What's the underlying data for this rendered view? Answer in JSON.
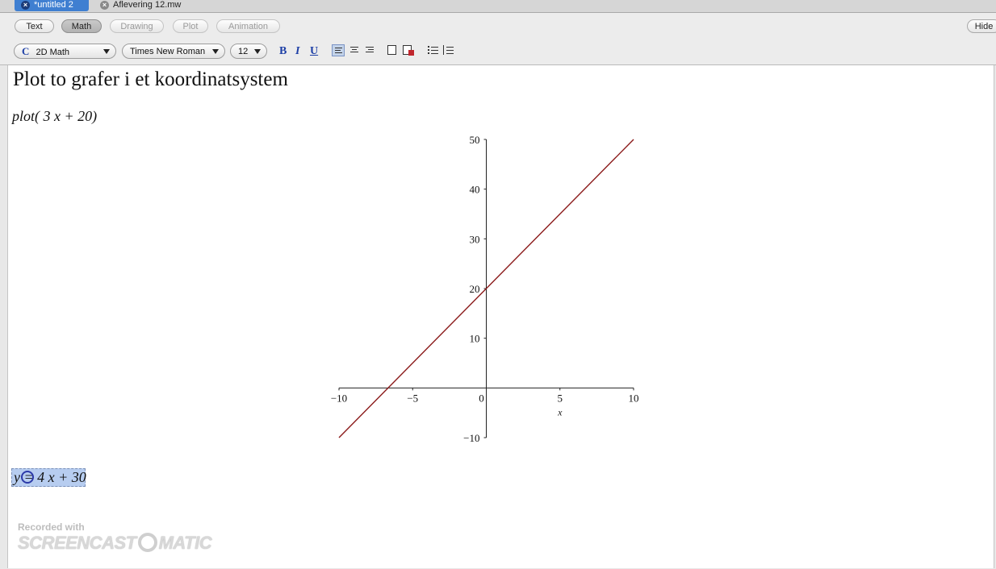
{
  "tabs": [
    {
      "label": "*untitled 2",
      "active": true
    },
    {
      "label": "Aflevering 12.mw",
      "active": false
    }
  ],
  "modes": {
    "text": "Text",
    "math": "Math",
    "drawing": "Drawing",
    "plot": "Plot",
    "animation": "Animation",
    "hide": "Hide"
  },
  "format": {
    "style": "2D Math",
    "style_prefix": "C",
    "font": "Times New Roman",
    "size": "12",
    "bold": "B",
    "italic": "I",
    "underline": "U"
  },
  "document": {
    "title": "Plot to grafer i et koordinatsystem",
    "command": "plot( 3 x + 20)",
    "editing_expr": "y = 4 x + 30"
  },
  "chart_data": {
    "type": "line",
    "xlabel": "x",
    "xlim": [
      -10,
      10
    ],
    "ylim": [
      -10,
      50
    ],
    "x_ticks": [
      -10,
      -5,
      0,
      5,
      10
    ],
    "y_ticks": [
      -10,
      10,
      20,
      30,
      40,
      50
    ],
    "x_tick_labels": [
      "−10",
      "−5",
      "0",
      "5",
      "10"
    ],
    "y_tick_labels": [
      "−10",
      "10",
      "20",
      "30",
      "40",
      "50"
    ],
    "series": [
      {
        "expr": "3x+20",
        "x": [
          -10,
          10
        ],
        "y": [
          -10,
          50
        ],
        "color": "#8b1a1a"
      }
    ]
  },
  "watermark": {
    "line1": "Recorded with",
    "line2a": "SCREENCAST",
    "line2b": "MATIC"
  }
}
